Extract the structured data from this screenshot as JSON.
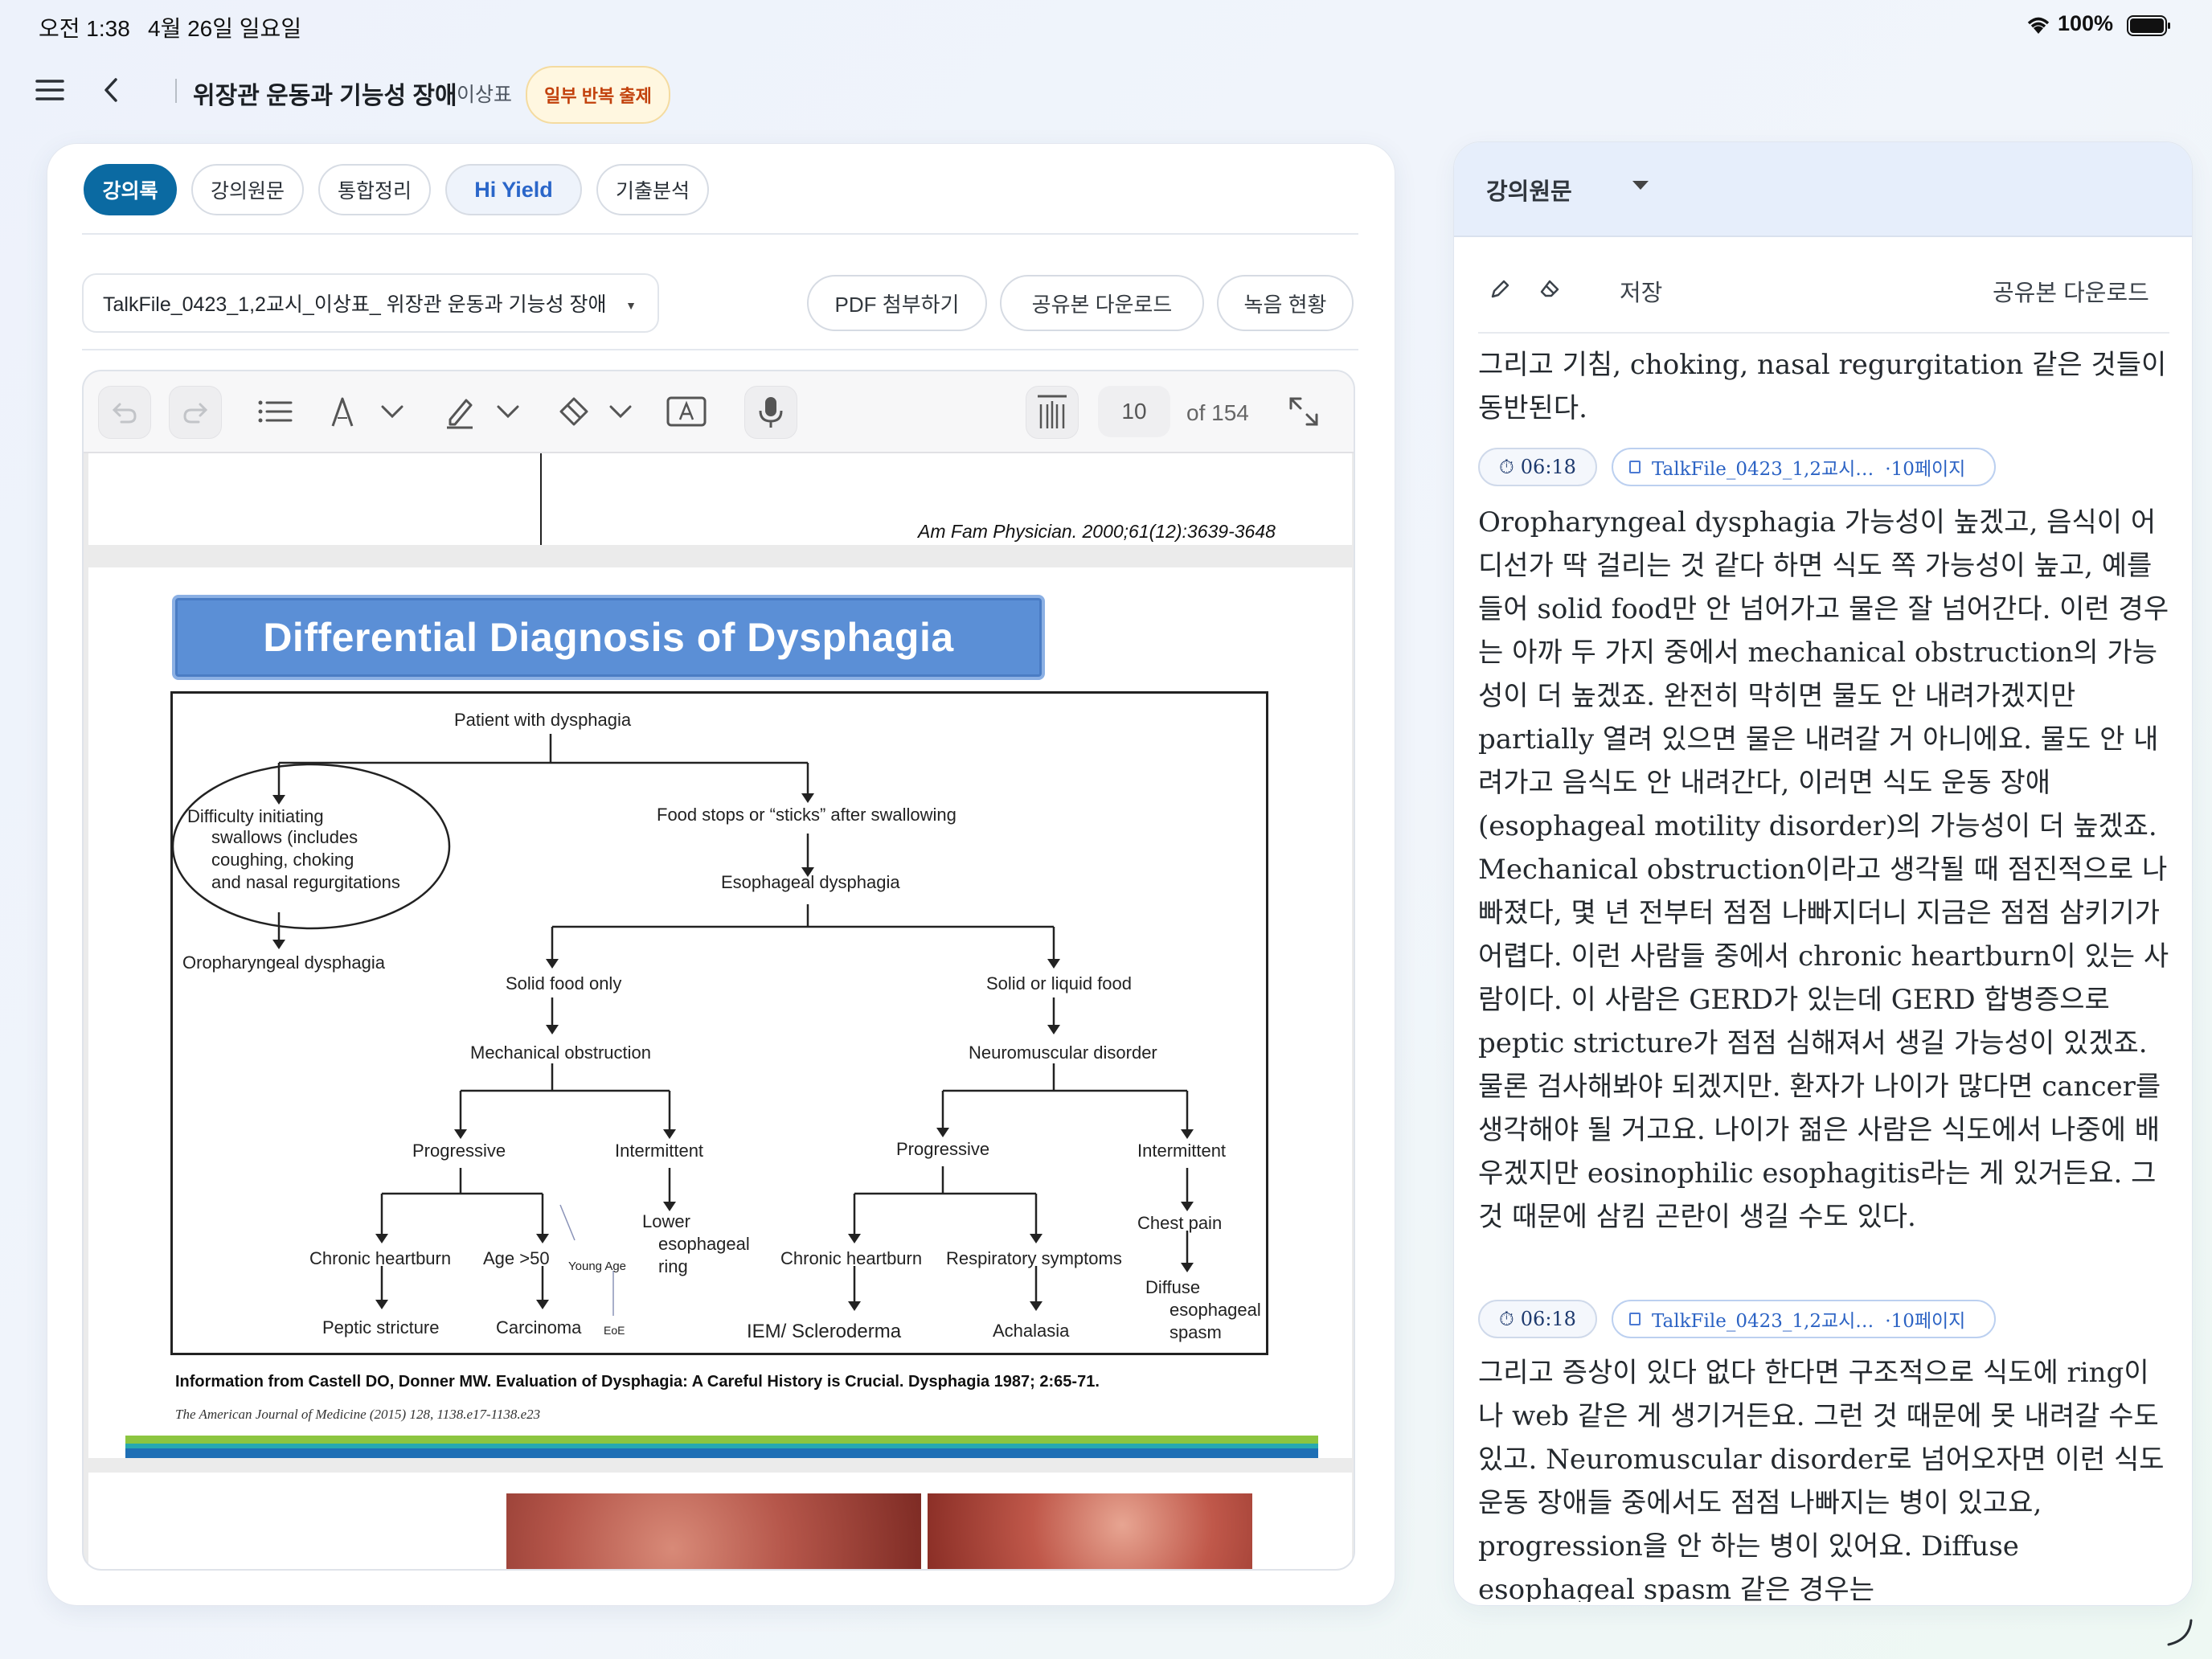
{
  "status_bar": {
    "time": "오전 1:38",
    "date": "4월 26일 일요일",
    "battery": "100%"
  },
  "header": {
    "title": "위장관 운동과 기능성 장애",
    "professor": "이상표",
    "badge": "일부 반복 출제"
  },
  "tabs": [
    "강의록",
    "강의원문",
    "통합정리",
    "Hi Yield",
    "기출분석"
  ],
  "file": {
    "name": "TalkFile_0423_1,2교시_이상표_ 위장관 운동과 기능성 장애",
    "actions": [
      "PDF 첨부하기",
      "공유본 다운로드",
      "녹음 현황"
    ]
  },
  "viewer": {
    "current_page": "10",
    "total_pages": "of 154",
    "prev_citation": "Am Fam Physician. 2000;61(12):3639-3648",
    "slide_title": "Differential Diagnosis of Dysphagia",
    "flow": {
      "root": "Patient with dysphagia",
      "difficulty": [
        "Difficulty initiating",
        "swallows (includes",
        "coughing, choking",
        "and nasal regurgitations"
      ],
      "oropharyngeal": "Oropharyngeal dysphagia",
      "food_stops": "Food stops or “sticks” after swallowing",
      "esophageal": "Esophageal dysphagia",
      "solid_only": "Solid food only",
      "solid_liquid": "Solid or liquid food",
      "mechanical": "Mechanical obstruction",
      "neuromuscular": "Neuromuscular disorder",
      "progressive_l": "Progressive",
      "intermittent_l": "Intermittent",
      "progressive_r": "Progressive",
      "intermittent_r": "Intermittent",
      "chronic_hb_l": "Chronic heartburn",
      "age50": "Age >50",
      "young_age": "Young Age",
      "lower_ring": [
        "Lower",
        "esophageal",
        "ring"
      ],
      "chronic_hb_r": "Chronic heartburn",
      "respiratory": "Respiratory symptoms",
      "chest_pain": "Chest pain",
      "peptic": "Peptic stricture",
      "carcinoma": "Carcinoma",
      "eoe": "EoE",
      "iem": "IEM/ Scleroderma",
      "achalasia": "Achalasia",
      "des": [
        "Diffuse",
        "esophageal",
        "spasm"
      ]
    },
    "reference_1": "Information from Castell DO, Donner MW. Evaluation of Dysphagia: A Careful History is Crucial. Dysphagia 1987; 2:65-71.",
    "reference_2": "The American Journal of Medicine (2015) 128, 1138.e17-1138.e23"
  },
  "transcript": {
    "title": "강의원문",
    "save": "저장",
    "download": "공유본 다운로드",
    "intro": "그리고 기침, choking, nasal regurgitation 같은 것들이 동반된다.",
    "segments": [
      {
        "time": "06:18",
        "source": "TalkFile_0423_1,2교시…",
        "page": "·10페이지",
        "text": "Oropharyngeal dysphagia 가능성이 높겠고, 음식이 어디선가 딱 걸리는 것 같다 하면 식도 쪽 가능성이 높고, 예를 들어 solid food만 안 넘어가고 물은 잘 넘어간다. 이런 경우는 아까 두 가지 중에서 mechanical obstruction의 가능성이 더 높겠죠. 완전히 막히면 물도 안 내려가겠지만 partially 열려 있으면 물은 내려갈 거 아니에요. 물도 안 내려가고 음식도 안 내려간다, 이러면 식도 운동 장애(esophageal motility disorder)의 가능성이 더 높겠죠. Mechanical obstruction이라고 생각될 때 점진적으로 나빠졌다, 몇 년 전부터 점점 나빠지더니 지금은 점점 삼키기가 어렵다. 이런 사람들 중에서 chronic heartburn이 있는 사람이다. 이 사람은 GERD가 있는데 GERD 합병증으로 peptic stricture가 점점 심해져서 생길 가능성이 있겠죠. 물론 검사해봐야 되겠지만. 환자가 나이가 많다면 cancer를 생각해야 될 거고요. 나이가 젊은 사람은 식도에서 나중에 배우겠지만 eosinophilic esophagitis라는 게 있거든요. 그것 때문에 삼킴 곤란이 생길 수도 있다."
      },
      {
        "time": "06:18",
        "source": "TalkFile_0423_1,2교시…",
        "page": "·10페이지",
        "text": "그리고 증상이 있다 없다 한다면 구조적으로 식도에 ring이나 web 같은 게 생기거든요. 그런 것 때문에 못 내려갈 수도 있고. Neuromuscular disorder로 넘어오자면 이런 식도 운동 장애들 중에서도 점점 나빠지는 병이 있고요, progression을 안 하는 병이 있어요. Diffuse esophageal spasm 같은 경우는"
      }
    ]
  }
}
